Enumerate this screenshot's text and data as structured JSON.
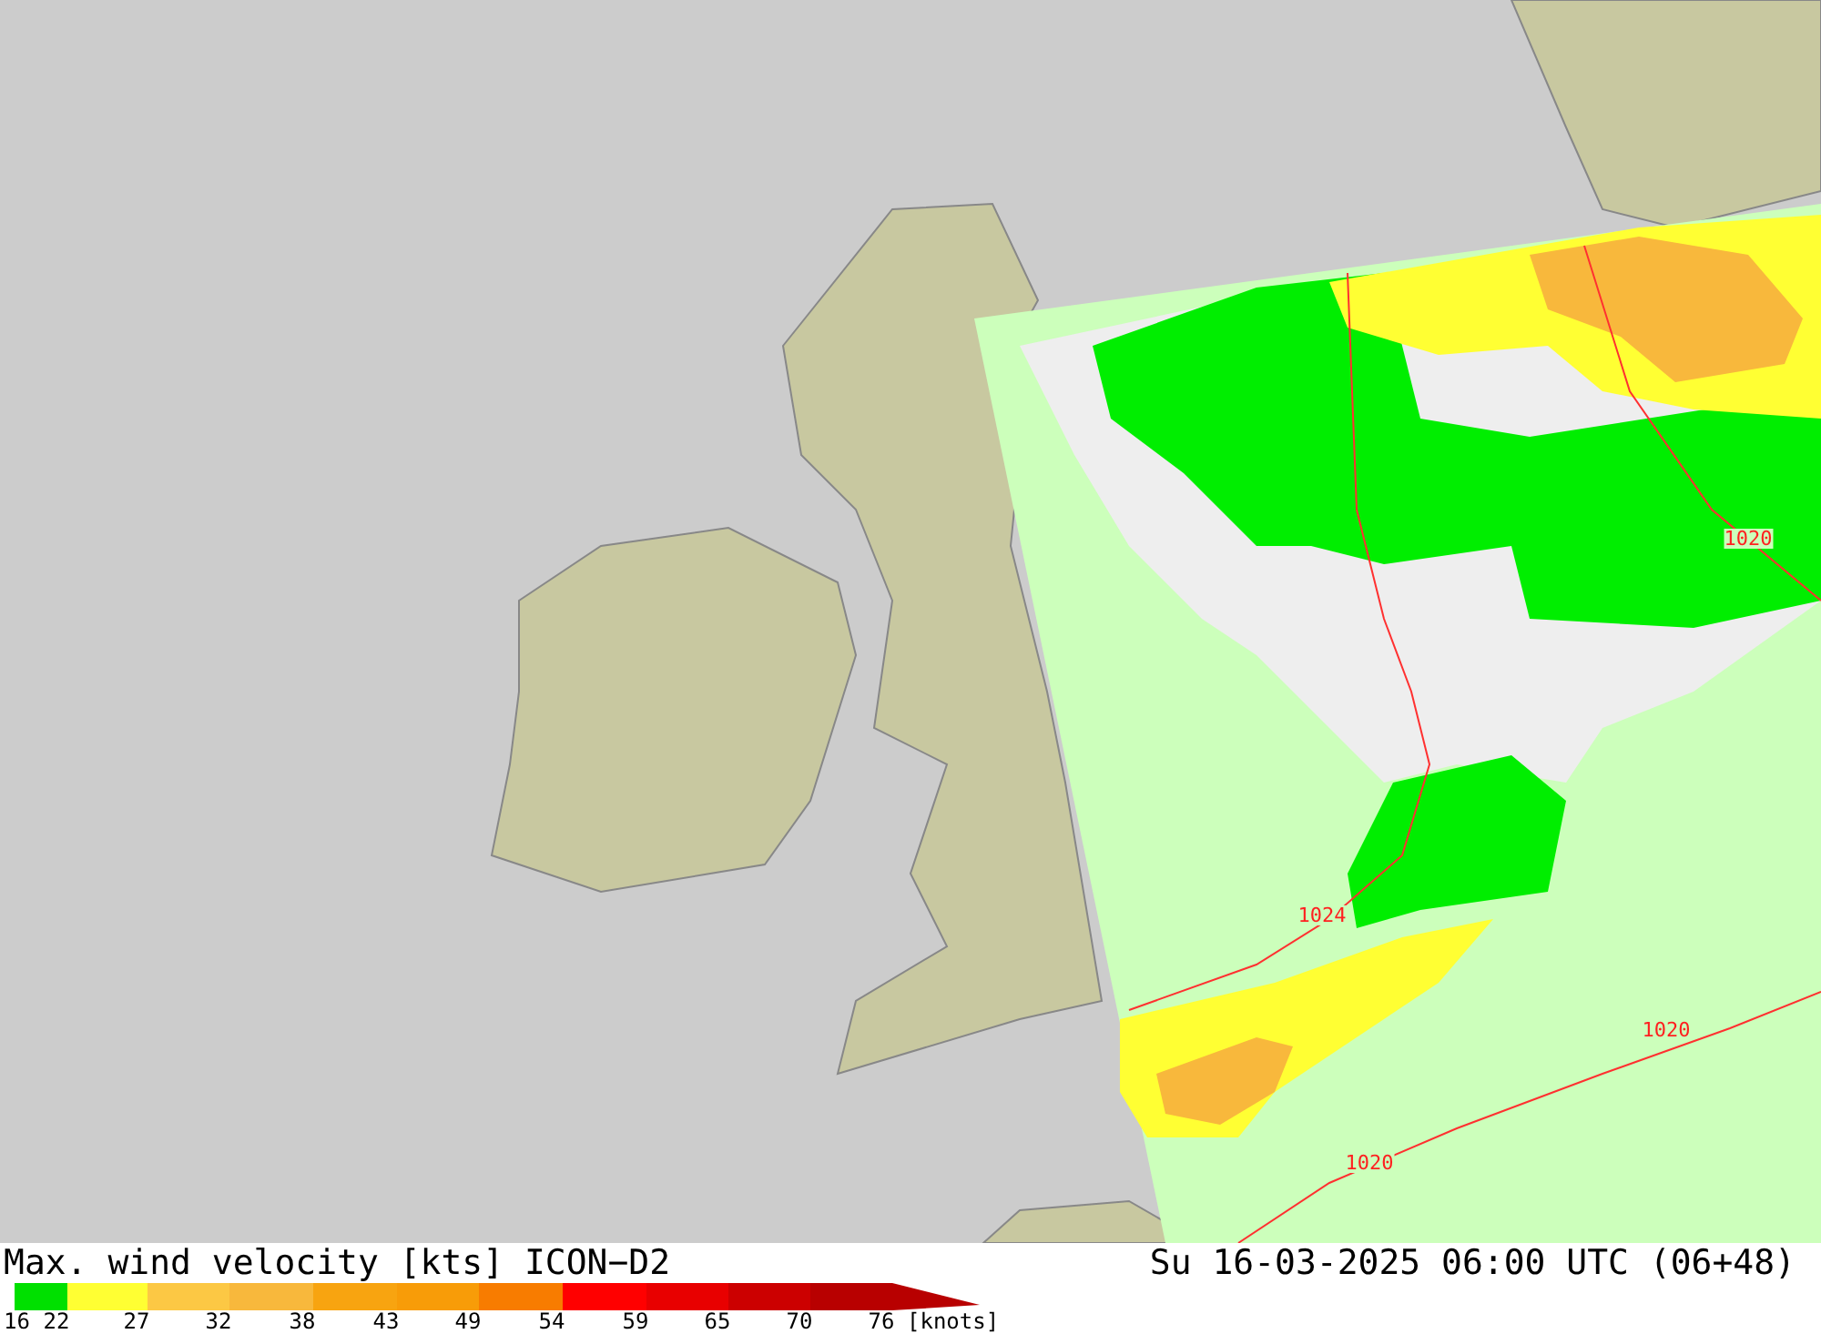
{
  "map": {
    "isobar_labels": [
      {
        "text": "1020"
      },
      {
        "text": "1024"
      },
      {
        "text": "1020"
      },
      {
        "text": "1020"
      }
    ]
  },
  "footer": {
    "title": "Max. wind velocity [kts] ICON−D2",
    "datetime": "Su 16-03-2025 06:00 UTC (06+48)"
  },
  "legend": {
    "start_label": "16",
    "unit": "[knots]",
    "segments": [
      {
        "color": "#00e000",
        "label": "22"
      },
      {
        "color": "#ffff33",
        "label": "27"
      },
      {
        "color": "#fcc844",
        "label": "32"
      },
      {
        "color": "#f8b83c",
        "label": "38"
      },
      {
        "color": "#f8a410",
        "label": "43"
      },
      {
        "color": "#f89c08",
        "label": "49"
      },
      {
        "color": "#f87c00",
        "label": "54"
      },
      {
        "color": "#ff0000",
        "label": "59"
      },
      {
        "color": "#e80000",
        "label": "65"
      },
      {
        "color": "#cc0000",
        "label": "70"
      },
      {
        "color": "#b80000",
        "label": "76"
      }
    ]
  }
}
